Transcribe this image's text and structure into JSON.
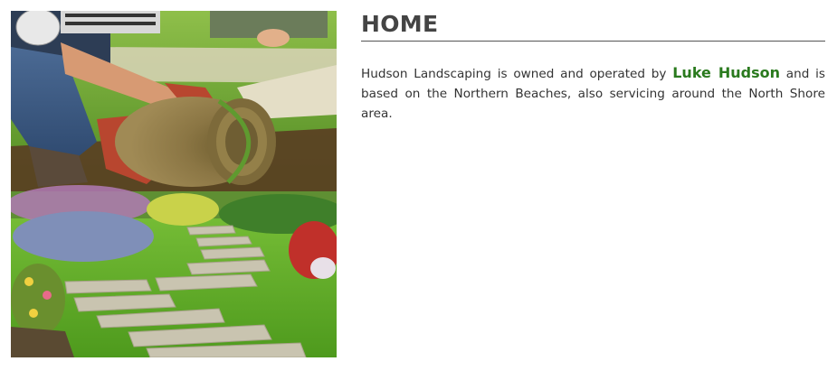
{
  "page": {
    "heading": "HOME"
  },
  "intro": {
    "before": "Hudson Landscaping is owned and operated by ",
    "owner": "Luke Hudson",
    "after": " and is based on the Northern Beaches, also servicing around the North Shore area."
  },
  "colors": {
    "owner_name": "#2a7a1e",
    "heading": "#444444",
    "body_text": "#333333"
  },
  "images": {
    "hero_icon": "turf-laying-and-garden-path-photo"
  }
}
